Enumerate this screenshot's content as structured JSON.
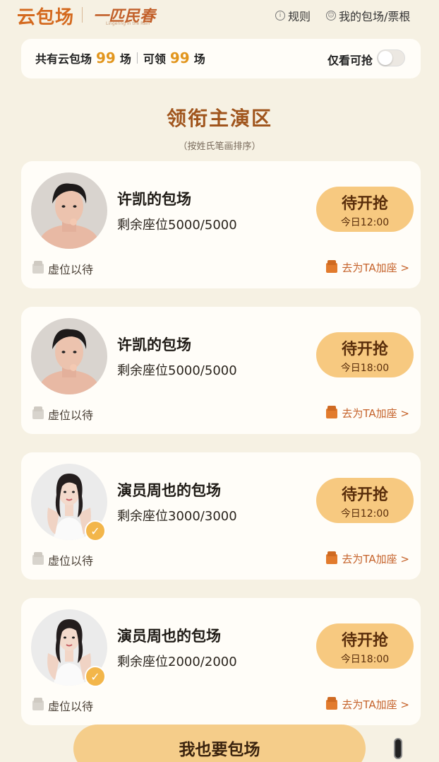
{
  "header": {
    "logo": "云包场",
    "film_logo": "一匹民春",
    "film_logo_sub": "Lingering in the Rain",
    "rules_label": "规则",
    "my_label": "我的包场/票根"
  },
  "stats": {
    "total_prefix": "共有云包场",
    "total_count": "99",
    "total_suffix": "场",
    "claim_prefix": "可领",
    "claim_count": "99",
    "claim_suffix": "场",
    "filter_label": "仅看可抢",
    "filter_on": false
  },
  "section": {
    "title": "领衔主演区",
    "subtitle": "（按姓氏笔画排序）"
  },
  "cards": [
    {
      "name": "许凯的包场",
      "seats": "剩余座位5000/5000",
      "button": "待开抢",
      "time": "今日12:00",
      "status": "虚位以待",
      "action": "去为TA加座 >",
      "verified": false
    },
    {
      "name": "许凯的包场",
      "seats": "剩余座位5000/5000",
      "button": "待开抢",
      "time": "今日18:00",
      "status": "虚位以待",
      "action": "去为TA加座 >",
      "verified": false
    },
    {
      "name": "演员周也的包场",
      "seats": "剩余座位3000/3000",
      "button": "待开抢",
      "time": "今日12:00",
      "status": "虚位以待",
      "action": "去为TA加座 >",
      "verified": true
    },
    {
      "name": "演员周也的包场",
      "seats": "剩余座位2000/2000",
      "button": "待开抢",
      "time": "今日18:00",
      "status": "虚位以待",
      "action": "去为TA加座 >",
      "verified": true
    }
  ],
  "bottom": {
    "button": "我也要包场"
  },
  "colors": {
    "accent": "#e2961e",
    "title": "#a0551d",
    "button_bg": "#f7c980",
    "link": "#c5622a"
  }
}
